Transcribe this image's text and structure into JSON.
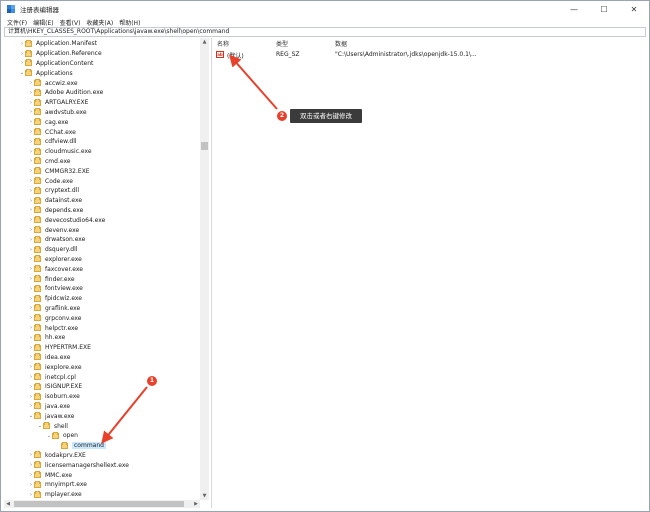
{
  "window": {
    "title": "注册表编辑器",
    "controls": [
      "—",
      "☐",
      "✕"
    ]
  },
  "menu": [
    "文件(F)",
    "编辑(E)",
    "查看(V)",
    "收藏夹(A)",
    "帮助(H)"
  ],
  "address": "计算机\\HKEY_CLASSES_ROOT\\Applications\\javaw.exe\\shell\\open\\command",
  "tree": [
    {
      "label": "Application.Manifest",
      "level": 1,
      "expander": "›"
    },
    {
      "label": "Application.Reference",
      "level": 1,
      "expander": "›"
    },
    {
      "label": "ApplicationContent",
      "level": 1,
      "expander": "›"
    },
    {
      "label": "Applications",
      "level": 1,
      "expander": "⌄"
    },
    {
      "label": "accwiz.exe",
      "level": 2,
      "expander": "›"
    },
    {
      "label": "Adobe Audition.exe",
      "level": 2,
      "expander": "›"
    },
    {
      "label": "ARTGALRY.EXE",
      "level": 2,
      "expander": "›"
    },
    {
      "label": "awdvstub.exe",
      "level": 2,
      "expander": "›"
    },
    {
      "label": "cag.exe",
      "level": 2,
      "expander": "›"
    },
    {
      "label": "CChat.exe",
      "level": 2,
      "expander": "›"
    },
    {
      "label": "cdfview.dll",
      "level": 2,
      "expander": "›"
    },
    {
      "label": "cloudmusic.exe",
      "level": 2,
      "expander": "›"
    },
    {
      "label": "cmd.exe",
      "level": 2,
      "expander": "›"
    },
    {
      "label": "CMMGR32.EXE",
      "level": 2,
      "expander": "›"
    },
    {
      "label": "Code.exe",
      "level": 2,
      "expander": "›"
    },
    {
      "label": "cryptext.dll",
      "level": 2,
      "expander": "›"
    },
    {
      "label": "datainst.exe",
      "level": 2,
      "expander": "›"
    },
    {
      "label": "depends.exe",
      "level": 2,
      "expander": "›"
    },
    {
      "label": "devecostudio64.exe",
      "level": 2,
      "expander": "›"
    },
    {
      "label": "devenv.exe",
      "level": 2,
      "expander": "›"
    },
    {
      "label": "drwatson.exe",
      "level": 2,
      "expander": "›"
    },
    {
      "label": "dsquery.dll",
      "level": 2,
      "expander": "›"
    },
    {
      "label": "explorer.exe",
      "level": 2,
      "expander": "›"
    },
    {
      "label": "faxcover.exe",
      "level": 2,
      "expander": "›"
    },
    {
      "label": "finder.exe",
      "level": 2,
      "expander": "›"
    },
    {
      "label": "fontview.exe",
      "level": 2,
      "expander": "›"
    },
    {
      "label": "fpidcwiz.exe",
      "level": 2,
      "expander": "›"
    },
    {
      "label": "graflink.exe",
      "level": 2,
      "expander": "›"
    },
    {
      "label": "grpconv.exe",
      "level": 2,
      "expander": "›"
    },
    {
      "label": "helpctr.exe",
      "level": 2,
      "expander": "›"
    },
    {
      "label": "hh.exe",
      "level": 2,
      "expander": "›"
    },
    {
      "label": "HYPERTRM.EXE",
      "level": 2,
      "expander": "›"
    },
    {
      "label": "idea.exe",
      "level": 2,
      "expander": "›"
    },
    {
      "label": "iexplore.exe",
      "level": 2,
      "expander": "›"
    },
    {
      "label": "inetcpl.cpl",
      "level": 2,
      "expander": "›"
    },
    {
      "label": "ISIGNUP.EXE",
      "level": 2,
      "expander": "›"
    },
    {
      "label": "isoburn.exe",
      "level": 2,
      "expander": "›"
    },
    {
      "label": "java.exe",
      "level": 2,
      "expander": "›"
    },
    {
      "label": "javaw.exe",
      "level": 2,
      "expander": "⌄"
    },
    {
      "label": "shell",
      "level": 3,
      "expander": "⌄"
    },
    {
      "label": "open",
      "level": 4,
      "expander": "⌄"
    },
    {
      "label": "command",
      "level": 5,
      "expander": "",
      "selected": true
    },
    {
      "label": "kodakprv.EXE",
      "level": 2,
      "expander": "›"
    },
    {
      "label": "licensemanagershellext.exe",
      "level": 2,
      "expander": "›"
    },
    {
      "label": "MMC.exe",
      "level": 2,
      "expander": "›"
    },
    {
      "label": "mnyimprt.exe",
      "level": 2,
      "expander": "›"
    },
    {
      "label": "mplayer.exe",
      "level": 2,
      "expander": "›"
    }
  ],
  "list": {
    "headers": {
      "name": "名称",
      "type": "类型",
      "data": "数据"
    },
    "rows": [
      {
        "icon": "ab",
        "name": "(默认)",
        "type": "REG_SZ",
        "data": "\"C:\\Users\\Administrator\\.jdks\\openjdk-15.0.1\\..."
      }
    ]
  },
  "annotations": {
    "step1": "1",
    "step2": "2",
    "tooltip": "双击或者右键修改"
  },
  "colors": {
    "accent_red": "#e8412b",
    "selection": "#cce8ff",
    "folder": "#f6d27a"
  }
}
